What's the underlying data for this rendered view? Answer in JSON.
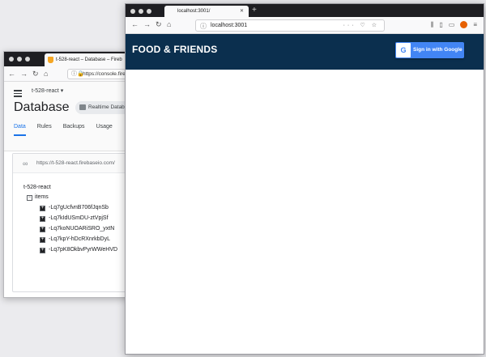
{
  "back_window": {
    "tab_title": "t-528-react – Database – Fireb",
    "url": "https://console.fireb",
    "project": "t-528-react",
    "page_title": "Database",
    "db_selector": "Realtime Databa",
    "tabs": [
      "Data",
      "Rules",
      "Backups",
      "Usage"
    ],
    "active_tab": "Data",
    "ref_url": "https://t-528-react.firebaseio.com/",
    "tree": {
      "root": "t-528-react",
      "items_label": "items",
      "children": [
        "-Lq7gUcfvnB706fJqnSb",
        "-Lq7kIdUSmDU-ztVpjSf",
        "-Lq7koNUOARiSRO_yxtN",
        "-Lq7kpY-hDcRXnrkbDyL",
        "-Lq7pK8OkbvPyrWWeHVD"
      ]
    }
  },
  "front_window": {
    "tab_title": "localhost:3001/",
    "url": "localhost:3001",
    "brand": "FOOD & FRIENDS",
    "signin_label": "Sign in with Google",
    "colors": {
      "appbar": "#0b2f4e",
      "google_blue": "#4285f4"
    }
  }
}
